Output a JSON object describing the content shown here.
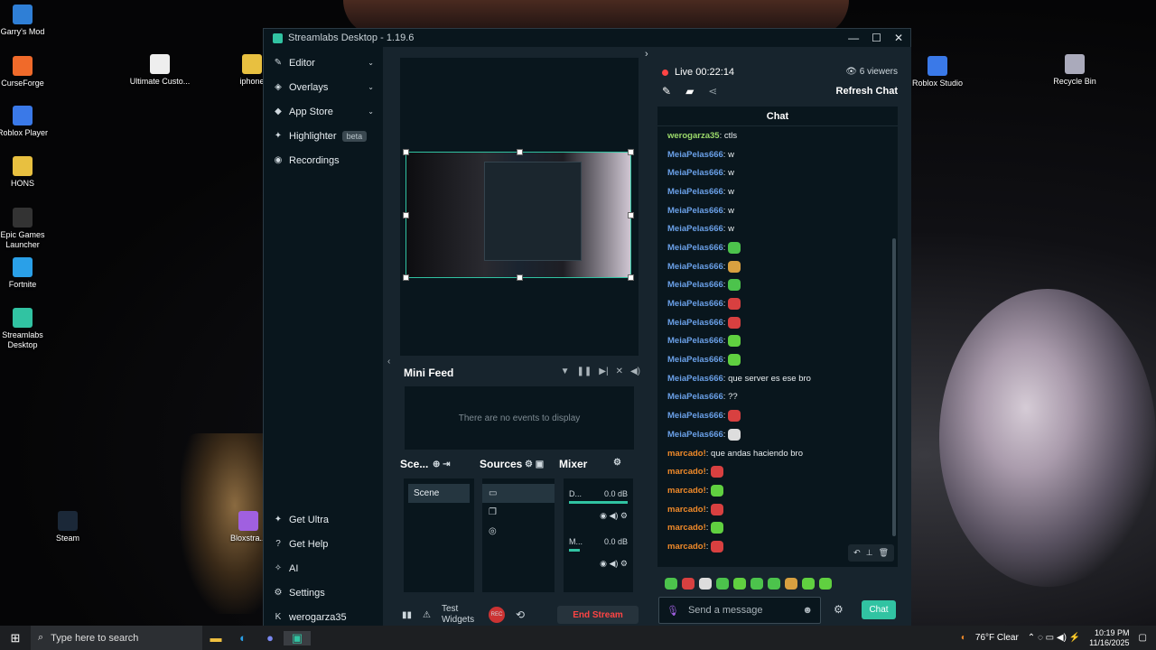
{
  "desktop": {
    "icons_left": [
      {
        "label": "Garry's Mod",
        "color": "#2f7fd6"
      },
      {
        "label": "CurseForge",
        "color": "#f06a2a"
      },
      {
        "label": "Roblox Player",
        "color": "#3a79e8"
      },
      {
        "label": "HONS",
        "color": "#e8c040"
      },
      {
        "label": "Epic Games Launcher",
        "color": "#333"
      },
      {
        "label": "Fortnite",
        "color": "#2aa0e8"
      },
      {
        "label": "Streamlabs Desktop",
        "color": "#31c3a2"
      },
      {
        "label": "Steam",
        "color": "#1b2838"
      }
    ],
    "icons_other": [
      {
        "label": "Ultimate Custo...",
        "color": "#eee"
      },
      {
        "label": "iphone",
        "color": "#e8c040"
      },
      {
        "label": "Roblox Studio",
        "color": "#3a79e8"
      },
      {
        "label": "Recycle Bin",
        "color": "#aab"
      },
      {
        "label": "Bloxstra...",
        "color": "#a060e0"
      }
    ]
  },
  "window": {
    "title": "Streamlabs Desktop - 1.19.6",
    "controls": [
      "—",
      "☐",
      "✕"
    ]
  },
  "sidebar": {
    "items": [
      {
        "label": "Editor",
        "icon": "✎",
        "chevron": "⌄"
      },
      {
        "label": "Overlays",
        "icon": "◈",
        "chevron": "⌄"
      },
      {
        "label": "App Store",
        "icon": "◆",
        "chevron": "⌄"
      },
      {
        "label": "Highlighter",
        "icon": "✦",
        "badge": "beta"
      },
      {
        "label": "Recordings",
        "icon": "◉"
      }
    ],
    "bottom": [
      {
        "label": "Get Ultra",
        "icon": "✦"
      },
      {
        "label": "Get Help",
        "icon": "?"
      },
      {
        "label": "AI",
        "icon": "✧"
      },
      {
        "label": "Settings",
        "icon": "⚙"
      },
      {
        "label": "werogarza35",
        "icon": "K"
      }
    ]
  },
  "minifeed": {
    "title": "Mini Feed",
    "empty": "There are no events to display"
  },
  "docks": {
    "scenes_title": "Sce...",
    "scene_item": "Scene",
    "sources_title": "Sources",
    "mixer_title": "Mixer",
    "mixer_channels": [
      {
        "name": "D...",
        "db": "0.0 dB"
      },
      {
        "name": "M...",
        "db": "0.0 dB"
      }
    ]
  },
  "footer": {
    "test_widgets": "Test Widgets",
    "rec": "REC",
    "end_stream": "End Stream"
  },
  "chat_panel": {
    "live": "Live 00:22:14",
    "viewers": "6 viewers",
    "refresh": "Refresh Chat",
    "header": "Chat",
    "placeholder": "Send a message",
    "send_label": "Chat"
  },
  "chat_messages": [
    {
      "user": "werogarza35",
      "text": ": ctls",
      "color": "#9bd96a"
    },
    {
      "user": "MeiaPelas666",
      "text": ": w",
      "color": "#6aa0e8"
    },
    {
      "user": "MeiaPelas666",
      "text": ": w",
      "color": "#6aa0e8"
    },
    {
      "user": "MeiaPelas666",
      "text": ": w",
      "color": "#6aa0e8"
    },
    {
      "user": "MeiaPelas666",
      "text": ": w",
      "color": "#6aa0e8"
    },
    {
      "user": "MeiaPelas666",
      "text": ": w",
      "color": "#6aa0e8"
    },
    {
      "user": "MeiaPelas666",
      "text": ":",
      "color": "#6aa0e8",
      "emote": "#4cc34c"
    },
    {
      "user": "MeiaPelas666",
      "text": ":",
      "color": "#6aa0e8",
      "emote": "#d8a040"
    },
    {
      "user": "MeiaPelas666",
      "text": ":",
      "color": "#6aa0e8",
      "emote": "#4cc34c"
    },
    {
      "user": "MeiaPelas666",
      "text": ":",
      "color": "#6aa0e8",
      "emote": "#d84040"
    },
    {
      "user": "MeiaPelas666",
      "text": ":",
      "color": "#6aa0e8",
      "emote": "#d84040"
    },
    {
      "user": "MeiaPelas666",
      "text": ":",
      "color": "#6aa0e8",
      "emote": "#60d040"
    },
    {
      "user": "MeiaPelas666",
      "text": ":",
      "color": "#6aa0e8",
      "emote": "#60d040"
    },
    {
      "user": "MeiaPelas666",
      "text": ": que server es ese bro",
      "color": "#6aa0e8"
    },
    {
      "user": "MeiaPelas666",
      "text": ": ??",
      "color": "#6aa0e8"
    },
    {
      "user": "MeiaPelas666",
      "text": ":",
      "color": "#6aa0e8",
      "emote": "#d84040"
    },
    {
      "user": "MeiaPelas666",
      "text": ":",
      "color": "#6aa0e8",
      "emote": "#dddddd"
    },
    {
      "user": "marcado!",
      "text": ": que andas haciendo bro",
      "color": "#f08a2a"
    },
    {
      "user": "marcado!",
      "text": ":",
      "color": "#f08a2a",
      "emote": "#d84040"
    },
    {
      "user": "marcado!",
      "text": ":",
      "color": "#f08a2a",
      "emote": "#60d040"
    },
    {
      "user": "marcado!",
      "text": ":",
      "color": "#f08a2a",
      "emote": "#d84040"
    },
    {
      "user": "marcado!",
      "text": ":",
      "color": "#f08a2a",
      "emote": "#60d040"
    },
    {
      "user": "marcado!",
      "text": ":",
      "color": "#f08a2a",
      "emote": "#d84040"
    }
  ],
  "emote_bar": [
    "#4cc34c",
    "#d84040",
    "#dddddd",
    "#4cc34c",
    "#60d040",
    "#4cc34c",
    "#4cc34c",
    "#d8a040",
    "#60d040",
    "#60d040"
  ],
  "taskbar": {
    "search_placeholder": "Type here to search",
    "weather": "76°F Clear",
    "time": "10:19 PM",
    "date": "11/16/2025"
  },
  "colors": {
    "accent": "#31c3a2",
    "live": "#ff4444"
  }
}
